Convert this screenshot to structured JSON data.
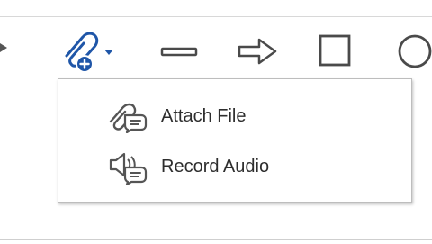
{
  "toolbar": {
    "tools": [
      {
        "icon": "dropdown-arrow-icon"
      },
      {
        "icon": "attach-add-icon",
        "has_dropdown": true
      },
      {
        "icon": "line-icon"
      },
      {
        "icon": "arrow-icon"
      },
      {
        "icon": "rectangle-icon"
      },
      {
        "icon": "ellipse-icon"
      }
    ]
  },
  "menu": {
    "items": [
      {
        "label": "Attach File",
        "icon": "attach-file-icon"
      },
      {
        "label": "Record Audio",
        "icon": "record-audio-icon"
      }
    ]
  },
  "colors": {
    "accent": "#1f56a8",
    "icon_gray": "#4a4a4a",
    "menu_border": "#bdbdbd",
    "text": "#2e2e2e"
  }
}
